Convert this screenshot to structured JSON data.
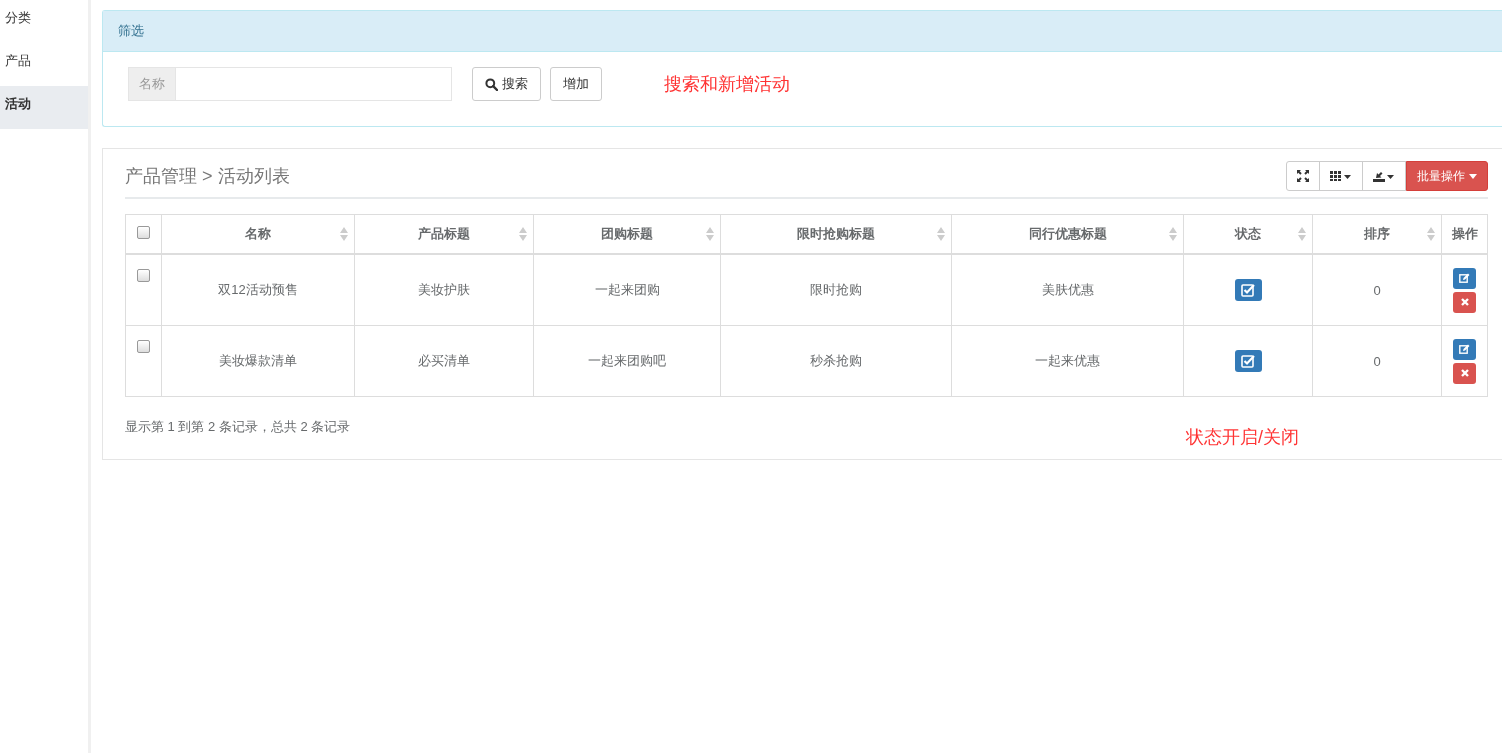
{
  "sidebar": {
    "items": [
      {
        "label": "分类",
        "selected": false
      },
      {
        "label": "产品",
        "selected": false
      },
      {
        "label": "活动",
        "selected": true
      }
    ]
  },
  "filter_panel": {
    "title": "筛选",
    "name_field": {
      "label": "名称"
    },
    "search_button": "搜索",
    "add_button": "增加",
    "annotation": "搜索和新增活动"
  },
  "list_panel": {
    "breadcrumb": "产品管理 > 活动列表",
    "batch_button": "批量操作",
    "table": {
      "select_all_checked": false,
      "columns": [
        {
          "label": "名称",
          "sortable": true
        },
        {
          "label": "产品标题",
          "sortable": true
        },
        {
          "label": "团购标题",
          "sortable": true
        },
        {
          "label": "限时抢购标题",
          "sortable": true
        },
        {
          "label": "同行优惠标题",
          "sortable": true
        },
        {
          "label": "状态",
          "sortable": true
        },
        {
          "label": "排序",
          "sortable": true
        },
        {
          "label": "操作",
          "sortable": false
        }
      ],
      "rows": [
        {
          "selected": false,
          "name": "双12活动预售",
          "product_title": "美妆护肤",
          "group_title": "一起来团购",
          "flash_title": "限时抢购",
          "peer_title": "美肤优惠",
          "enabled": true,
          "sort": "0"
        },
        {
          "selected": false,
          "name": "美妆爆款清单",
          "product_title": "必买清单",
          "group_title": "一起来团购吧",
          "flash_title": "秒杀抢购",
          "peer_title": "一起来优惠",
          "enabled": true,
          "sort": "0"
        }
      ]
    },
    "pagination_info": "显示第 1 到第 2 条记录，总共 2 条记录",
    "annotation": "状态开启/关闭"
  }
}
